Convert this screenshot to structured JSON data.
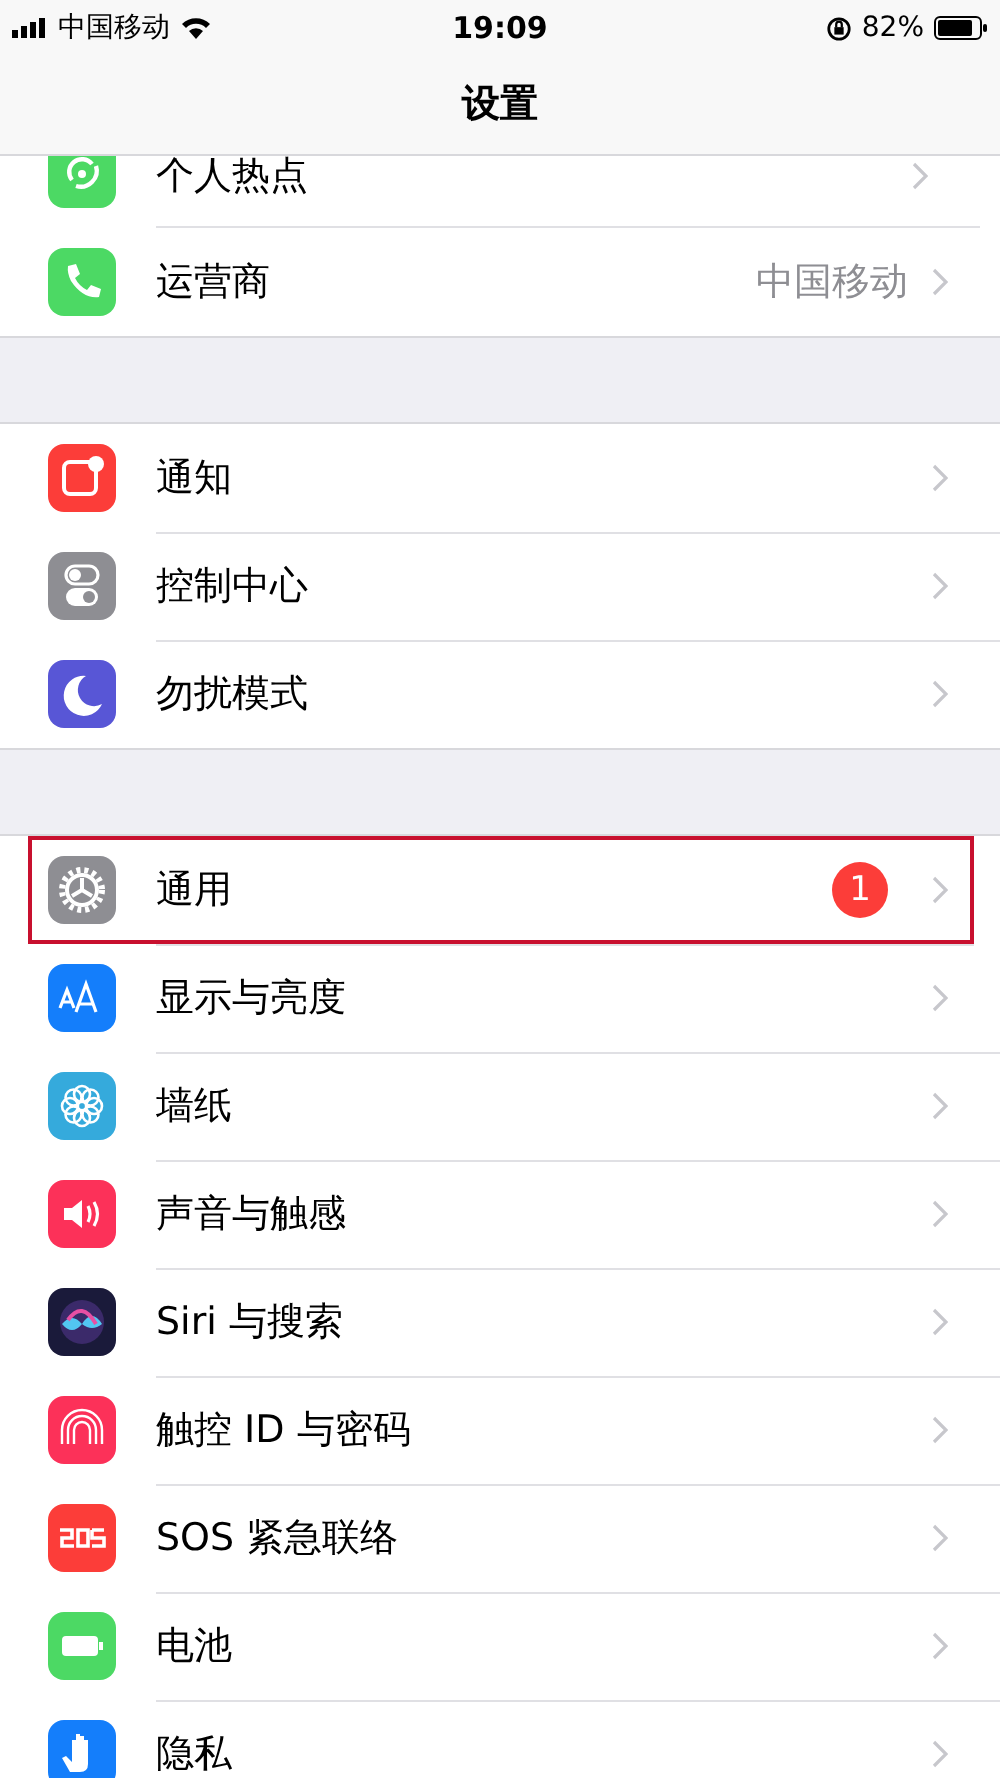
{
  "status_bar": {
    "carrier": "中国移动",
    "time": "19:09",
    "battery": "82%"
  },
  "window": {
    "title": "设置"
  },
  "sections": [
    {
      "items": [
        {
          "label": "个人热点"
        },
        {
          "label": "运营商",
          "value": "中国移动"
        }
      ]
    },
    {
      "items": [
        {
          "label": "通知"
        },
        {
          "label": "控制中心"
        },
        {
          "label": "勿扰模式"
        }
      ]
    },
    {
      "items": [
        {
          "label": "通用",
          "badge": "1",
          "highlighted": true
        },
        {
          "label": "显示与亮度",
          "highlighted": false
        },
        {
          "label": "墙纸",
          "highlighted": false
        },
        {
          "label": "声音与触感",
          "highlighted": false
        },
        {
          "label": "Siri 与搜索",
          "highlighted": false
        },
        {
          "label": "触控 ID 与密码",
          "highlighted": false
        },
        {
          "label": "SOS 紧急联络",
          "highlighted": false
        },
        {
          "label": "电池",
          "highlighted": false
        },
        {
          "label": "隐私",
          "highlighted": false
        }
      ]
    }
  ]
}
